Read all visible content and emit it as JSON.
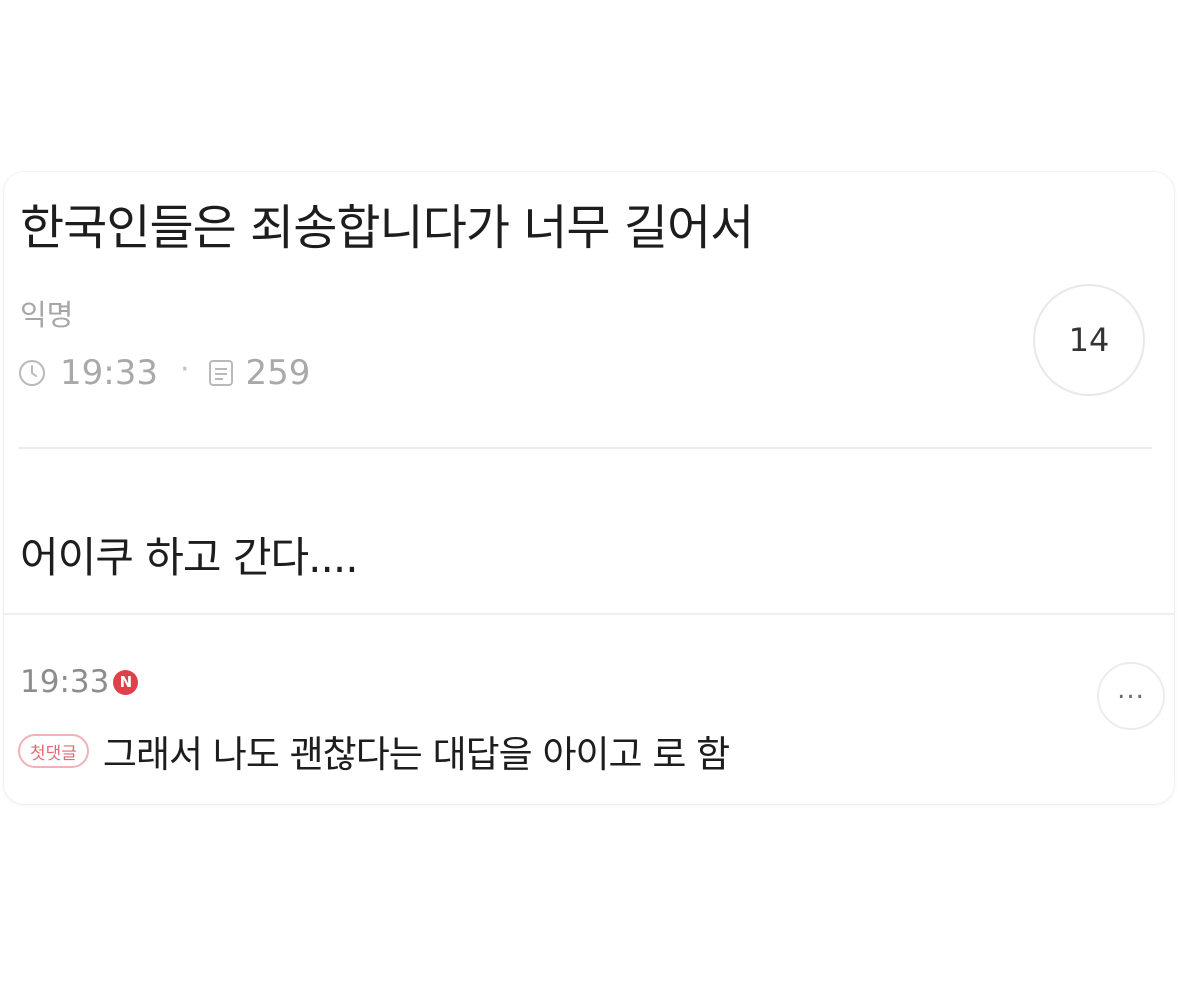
{
  "post": {
    "title": "한국인들은 죄송합니다가 너무 길어서",
    "author": "익명",
    "time": "19:33",
    "separator": "·",
    "views": "259",
    "comment_count": "14",
    "body": "어이쿠 하고 간다...."
  },
  "comment": {
    "time": "19:33",
    "new_badge": "N",
    "tag": "첫댓글",
    "text": "그래서 나도 괜찮다는 대답을 아이고 로 함",
    "more_label": "..."
  },
  "icons": {
    "clock": "clock-icon",
    "views": "document-icon",
    "more": "more-icon"
  },
  "colors": {
    "new_badge": "#e0404a",
    "tag_border": "#f0b2b6",
    "tag_text": "#e36a72",
    "muted_text": "#a9a9a9"
  }
}
